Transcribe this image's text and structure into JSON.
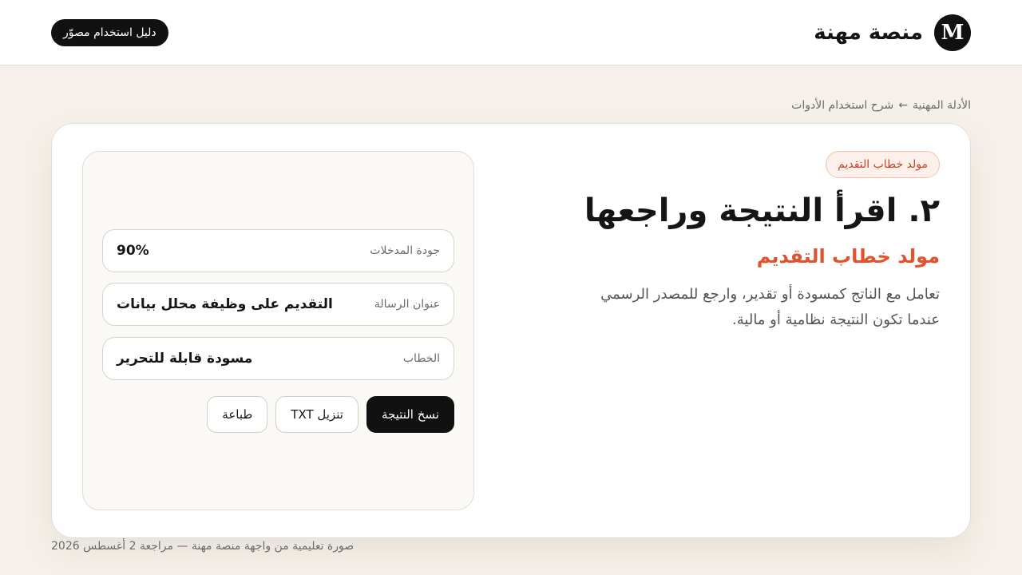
{
  "header": {
    "brand_logo_letter": "M",
    "brand_name": "منصة مهنة",
    "guide_button": "دليل استخدام مصوّر"
  },
  "breadcrumb": {
    "parent": "الأدلة المهنية",
    "separator": "←",
    "current": "شرح استخدام الأدوات"
  },
  "main": {
    "badge": "مولد خطاب التقديم",
    "title": "٢. اقرأ النتيجة وراجعها",
    "subtitle": "مولد خطاب التقديم",
    "description": "تعامل مع الناتج كمسودة أو تقدير، وارجع للمصدر الرسمي عندما تكون النتيجة نظامية أو مالية."
  },
  "result_panel": {
    "fields": [
      {
        "label": "جودة المدخلات",
        "value": "90%"
      },
      {
        "label": "عنوان الرسالة",
        "value": "التقديم على وظيفة محلل بيانات"
      },
      {
        "label": "الخطاب",
        "value": "مسودة قابلة للتحرير"
      }
    ],
    "actions": {
      "copy": "نسخ النتيجة",
      "download": "تنزيل TXT",
      "print": "طباعة"
    }
  },
  "footer": {
    "note": "صورة تعليمية من واجهة منصة مهنة — مراجعة 2 أغسطس 2026"
  },
  "colors": {
    "background": "#f5f1ea",
    "accent": "#e0532c",
    "dark": "#111111"
  }
}
